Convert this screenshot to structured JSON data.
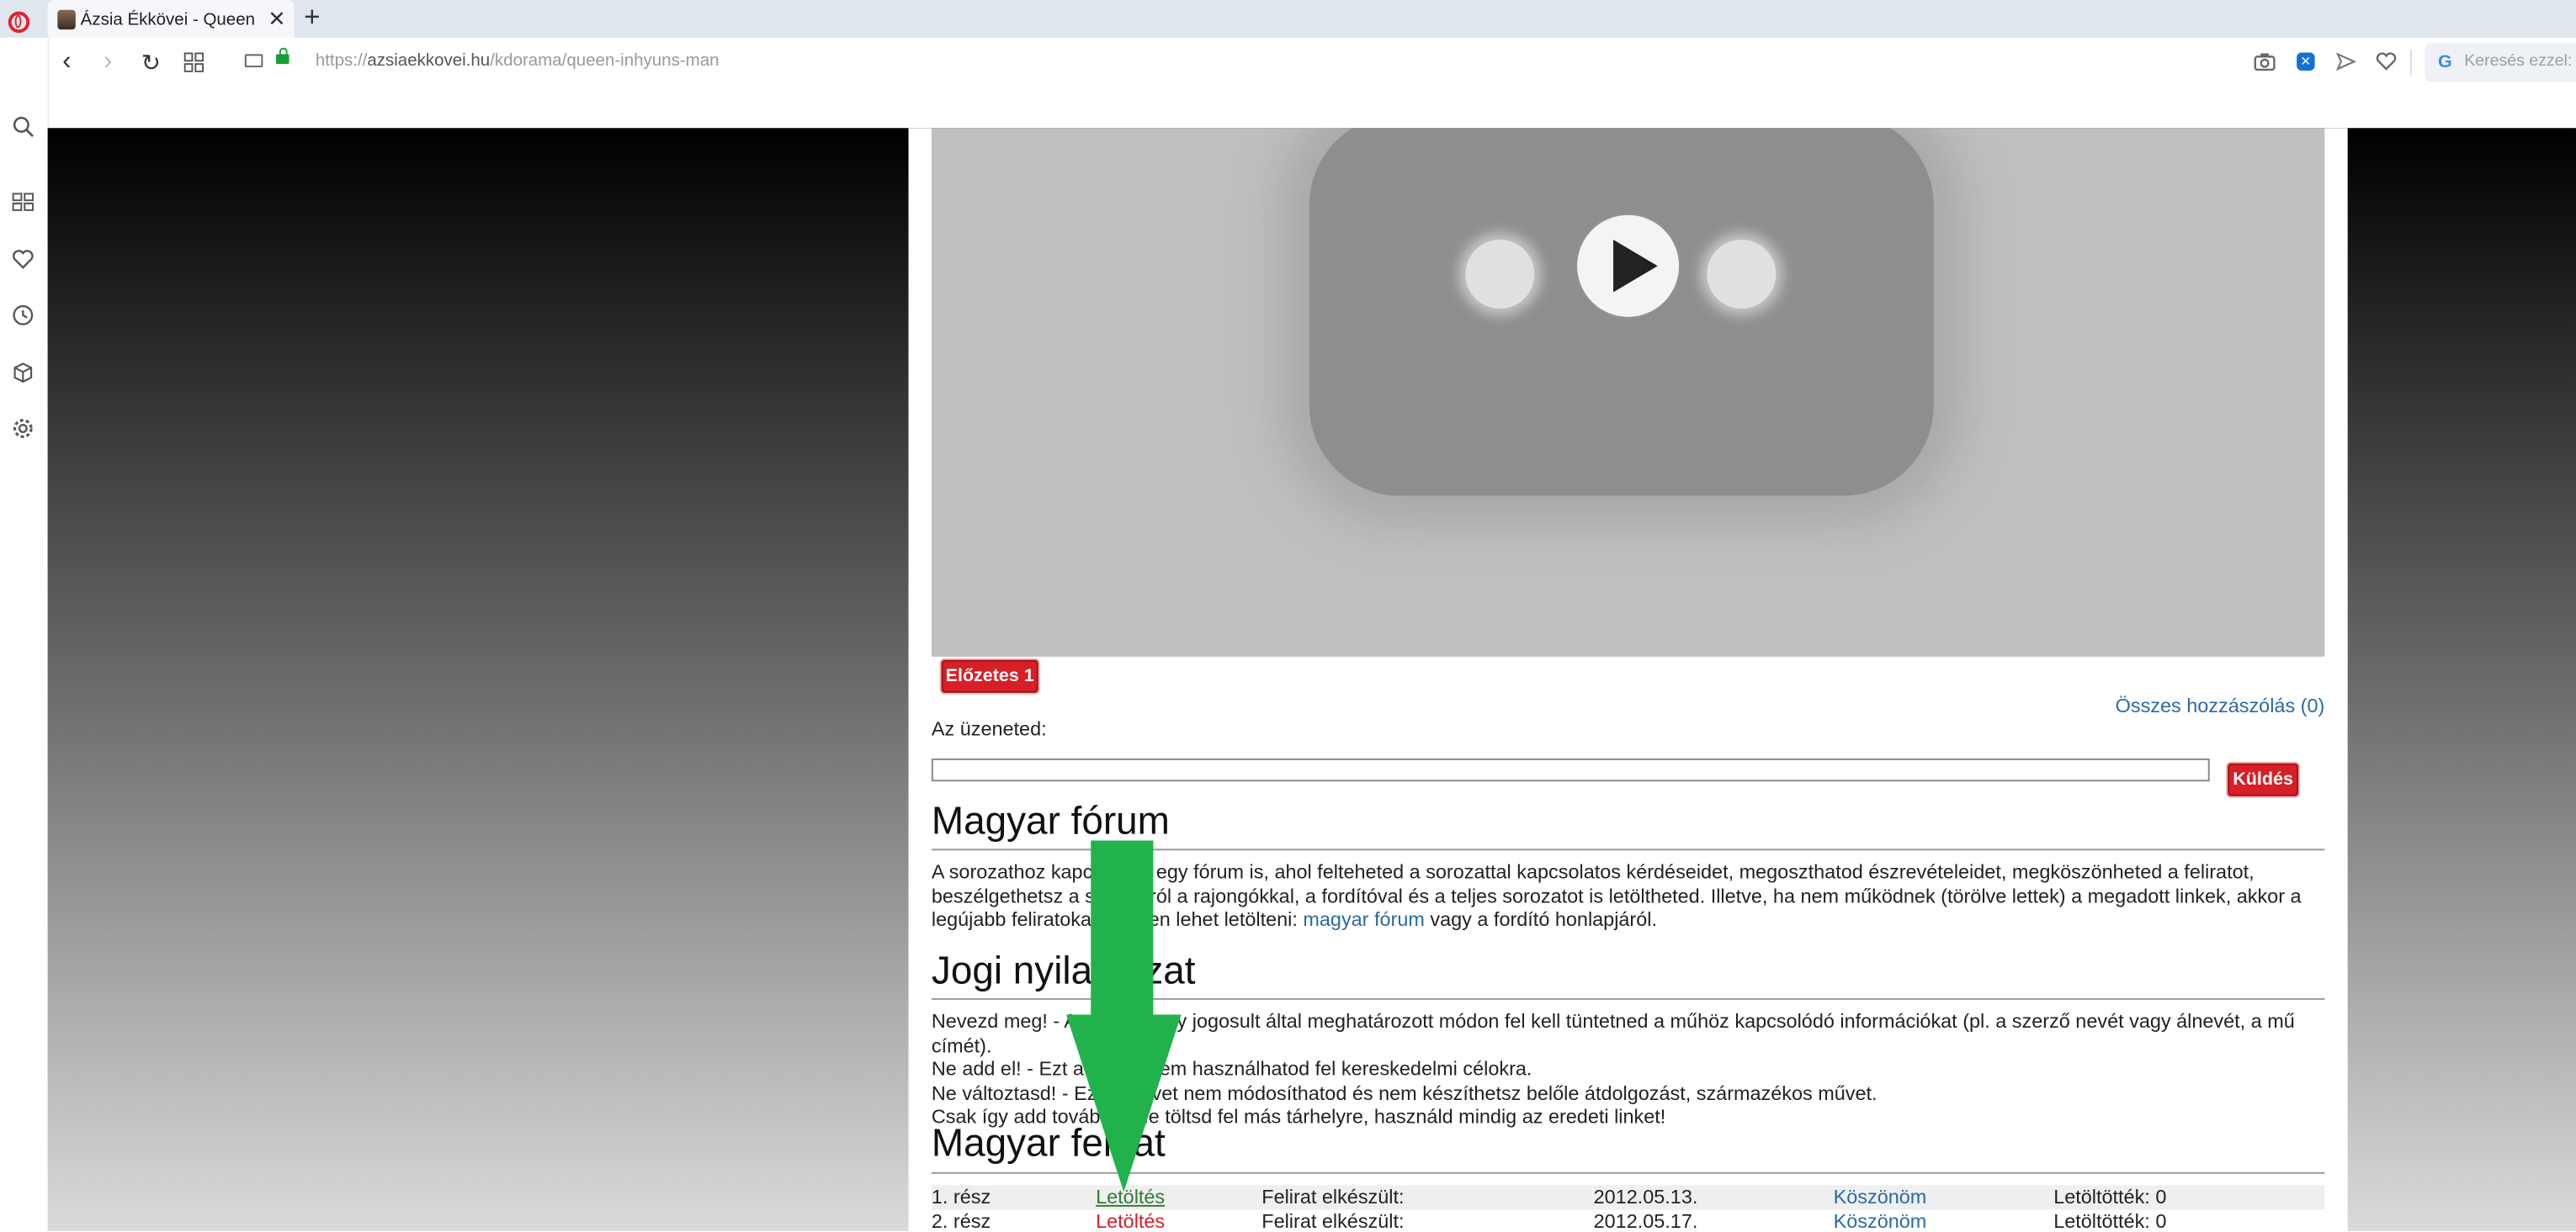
{
  "browser": {
    "tab_title": "Ázsia Ékkövei - Queen Inhyun's Man",
    "url_scheme": "https://",
    "url_domain": "azsiaekkovei.hu",
    "url_path": "/kdorama/queen-inhyuns-man",
    "search_placeholder": "Keresés ezzel: G"
  },
  "video": {
    "trailer_button": "Előzetes 1"
  },
  "comments": {
    "all_comments_link": "Összes hozzászólás (0)",
    "message_label": "Az üzeneted:",
    "message_value": "",
    "send_button": "Küldés"
  },
  "forum": {
    "heading": "Magyar fórum",
    "text_before_link": "A sorozathoz kapcsolódó egy fórum is, ahol felteheted a sorozattal kapcsolatos kérdéseidet, megoszthatod észrevételeidet, megköszönheted a feliratot, beszélgethetsz a sorozatról a rajongókkal, a fordítóval és a teljes sorozatot is letöltheted. Illetve, ha nem működnek (törölve lettek) a megadott linkek, akkor a legújabb feliratokat is innen lehet letölteni: ",
    "link_text": "magyar fórum",
    "text_after_link": " vagy a fordító honlapjáról."
  },
  "legal": {
    "heading": "Jogi nyilatkozat",
    "lines": [
      "Nevezd meg! - A szerző vagy jogosult által meghatározott módon fel kell tüntetned a műhöz kapcsolódó információkat (pl. a szerző nevét vagy álnevét, a mű címét).",
      "Ne add el! - Ezt a művet nem használhatod fel kereskedelmi célokra.",
      "Ne változtasd! - Ezt a művet nem módosíthatod és nem készíthetsz belőle átdolgozást, származékos művet.",
      "Csak így add tovább! - Ne töltsd fel más tárhelyre, használd mindig az eredeti linket!"
    ]
  },
  "subtitles": {
    "heading": "Magyar felirat",
    "rows": [
      {
        "part": "1. rész",
        "download": "Letöltés",
        "status": "Felirat elkészült:",
        "date": "2012.05.13.",
        "thanks": "Köszönöm",
        "count": "Letöltötték: 0"
      },
      {
        "part": "2. rész",
        "download": "Letöltés",
        "status": "Felirat elkészült:",
        "date": "2012.05.17.",
        "thanks": "Köszönöm",
        "count": "Letöltötték: 0"
      }
    ]
  },
  "colors": {
    "accent_red": "#d61f26",
    "link_blue": "#2a6aa6",
    "arrow_green": "#22b24c"
  }
}
